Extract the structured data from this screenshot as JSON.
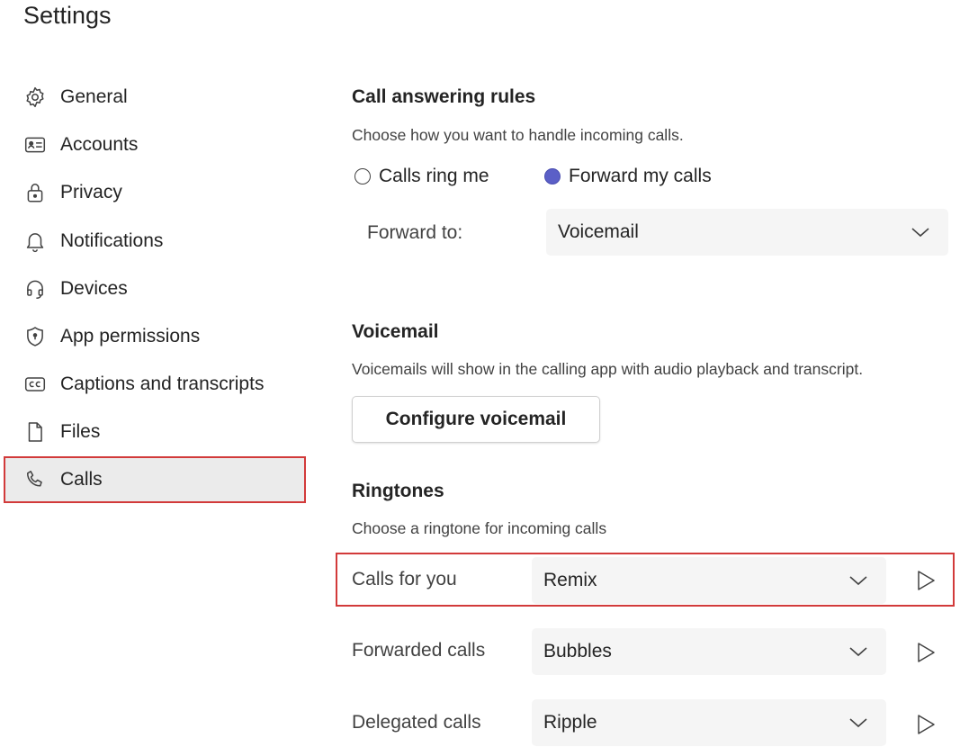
{
  "page": {
    "title": "Settings"
  },
  "sidebar": {
    "items": [
      {
        "label": "General",
        "icon": "gear-icon"
      },
      {
        "label": "Accounts",
        "icon": "id-card-icon"
      },
      {
        "label": "Privacy",
        "icon": "lock-icon"
      },
      {
        "label": "Notifications",
        "icon": "bell-icon"
      },
      {
        "label": "Devices",
        "icon": "headset-icon"
      },
      {
        "label": "App permissions",
        "icon": "shield-icon"
      },
      {
        "label": "Captions and transcripts",
        "icon": "closed-captions-icon"
      },
      {
        "label": "Files",
        "icon": "file-icon"
      },
      {
        "label": "Calls",
        "icon": "phone-icon",
        "active": true
      }
    ]
  },
  "call_answering": {
    "heading": "Call answering rules",
    "description": "Choose how you want to handle incoming calls.",
    "options": [
      {
        "label": "Calls ring me",
        "selected": false
      },
      {
        "label": "Forward my calls",
        "selected": true
      }
    ],
    "forward_label": "Forward to:",
    "forward_value": "Voicemail"
  },
  "voicemail": {
    "heading": "Voicemail",
    "description": "Voicemails will show in the calling app with audio playback and transcript.",
    "button_label": "Configure voicemail"
  },
  "ringtones": {
    "heading": "Ringtones",
    "description": "Choose a ringtone for incoming calls",
    "rows": [
      {
        "label": "Calls for you",
        "value": "Remix"
      },
      {
        "label": "Forwarded calls",
        "value": "Bubbles"
      },
      {
        "label": "Delegated calls",
        "value": "Ripple"
      }
    ]
  },
  "colors": {
    "accent": "#5b5fc7",
    "highlight": "#d23a3a",
    "active_bg": "#ebebeb"
  }
}
